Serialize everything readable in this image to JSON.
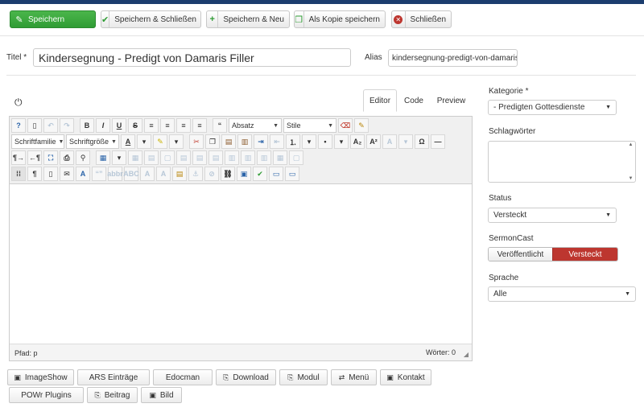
{
  "toolbar": {
    "save": "Speichern",
    "save_close": "Speichern & Schließen",
    "save_new": "Speichern & Neu",
    "save_copy": "Als Kopie speichern",
    "close": "Schließen"
  },
  "title": {
    "label": "Titel *",
    "value": "Kindersegnung - Predigt von Damaris Filler",
    "alias_label": "Alias",
    "alias_value": "kindersegnung-predigt-von-damaris"
  },
  "editor": {
    "tabs": [
      "Editor",
      "Code",
      "Preview"
    ],
    "format_select": "Absatz",
    "style_select": "Stile",
    "font_family_select": "Schriftfamilie",
    "font_size_select": "Schriftgröße",
    "status_path": "Pfad: p",
    "word_count": "Wörter: 0"
  },
  "extension_buttons": [
    {
      "label": "ImageShow",
      "icon": "image-icon"
    },
    {
      "label": "ARS Einträge",
      "icon": ""
    },
    {
      "label": "Edocman",
      "icon": ""
    },
    {
      "label": "Download",
      "icon": "file-icon"
    },
    {
      "label": "Modul",
      "icon": "file-icon"
    },
    {
      "label": "Menü",
      "icon": "share-icon"
    },
    {
      "label": "Kontakt",
      "icon": "contact-icon"
    },
    {
      "label": "POWr Plugins",
      "icon": ""
    },
    {
      "label": "Beitrag",
      "icon": "file-icon"
    },
    {
      "label": "Bild",
      "icon": "image-icon"
    }
  ],
  "sidebar": {
    "category_label": "Kategorie *",
    "category_value": "- Predigten Gottesdienste",
    "tags_label": "Schlagwörter",
    "status_label": "Status",
    "status_value": "Versteckt",
    "sermoncast_label": "SermonCast",
    "sermoncast_options": [
      "Veröffentlicht",
      "Versteckt"
    ],
    "sermoncast_selected": "Versteckt",
    "language_label": "Sprache",
    "language_value": "Alle"
  },
  "colors": {
    "primary_green": "#2f9c34",
    "danger_red": "#bd362f",
    "header_navy": "#1c3d6e"
  }
}
